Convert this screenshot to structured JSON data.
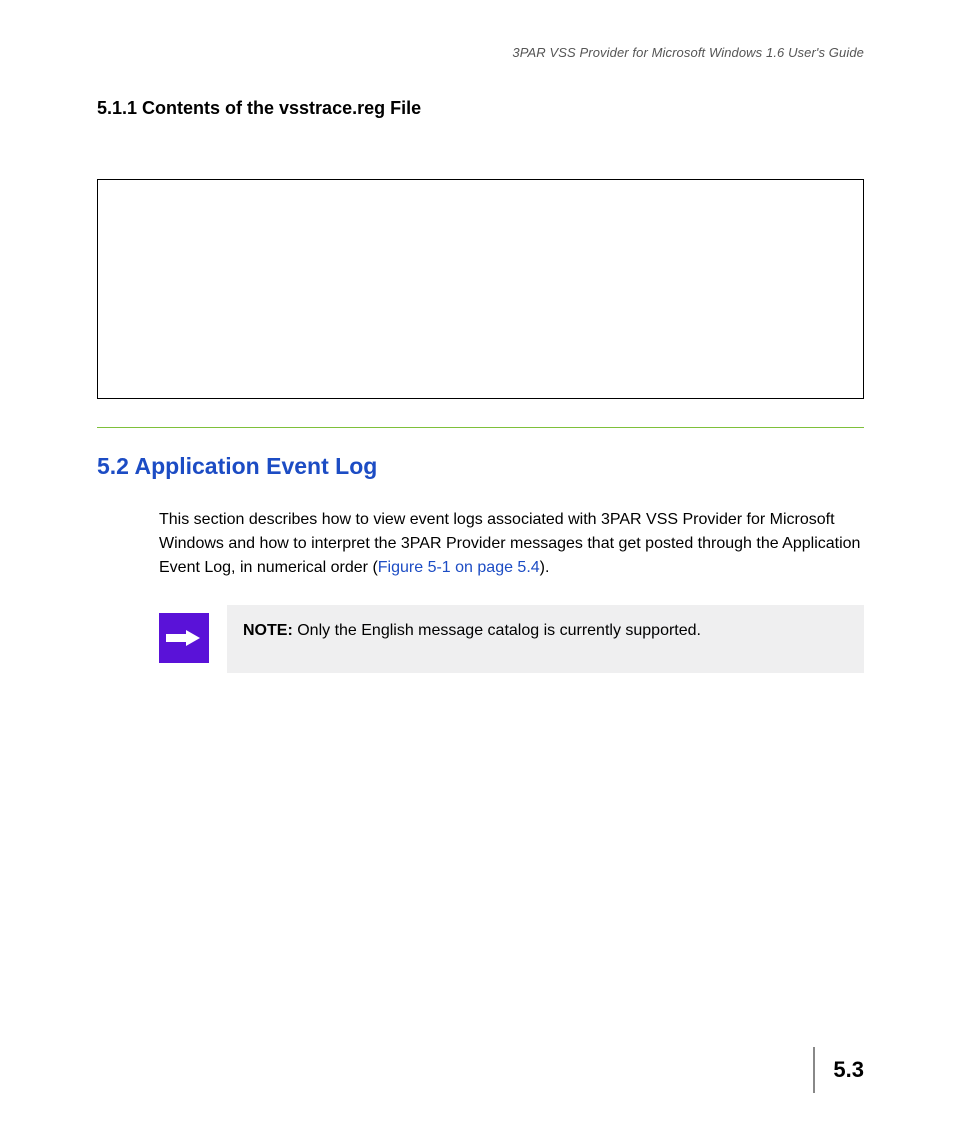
{
  "header": {
    "running_title": "3PAR VSS Provider for Microsoft Windows 1.6 User's Guide"
  },
  "subsection": {
    "heading": "5.1.1 Contents of the vsstrace.reg File"
  },
  "section": {
    "heading": "5.2  Application Event Log",
    "body_pre": "This section describes how to view event logs associated with 3PAR VSS Provider for Microsoft Windows and how to interpret the 3PAR Provider messages that get posted through the Application Event Log, in numerical order (",
    "body_link": "Figure 5-1 on page 5.4",
    "body_post": ")."
  },
  "note": {
    "label": "NOTE:",
    "text": " Only the English message catalog is currently supported."
  },
  "footer": {
    "page_number": "5.3"
  }
}
